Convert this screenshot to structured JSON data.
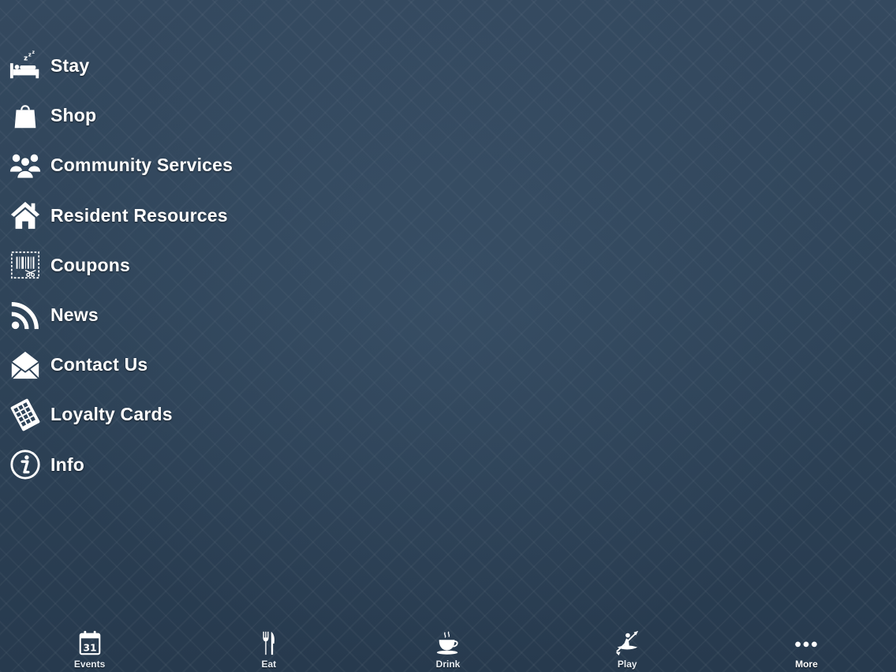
{
  "menu": {
    "items": [
      {
        "label": "Stay",
        "icon": "bed-icon"
      },
      {
        "label": "Shop",
        "icon": "shopping-bag-icon"
      },
      {
        "label": "Community Services",
        "icon": "people-icon"
      },
      {
        "label": "Resident Resources",
        "icon": "home-icon"
      },
      {
        "label": "Coupons",
        "icon": "coupon-icon"
      },
      {
        "label": "News",
        "icon": "rss-icon"
      },
      {
        "label": "Contact Us",
        "icon": "envelope-icon"
      },
      {
        "label": "Loyalty Cards",
        "icon": "loyalty-card-icon"
      },
      {
        "label": "Info",
        "icon": "info-icon"
      }
    ]
  },
  "tabbar": {
    "tabs": [
      {
        "label": "Events",
        "icon": "calendar-icon",
        "calendar_day": "31"
      },
      {
        "label": "Eat",
        "icon": "fork-knife-icon"
      },
      {
        "label": "Drink",
        "icon": "coffee-cup-icon"
      },
      {
        "label": "Play",
        "icon": "kayak-icon"
      },
      {
        "label": "More",
        "icon": "more-dots-icon"
      }
    ]
  },
  "colors": {
    "background": "#2e4358",
    "text": "#ffffff"
  }
}
